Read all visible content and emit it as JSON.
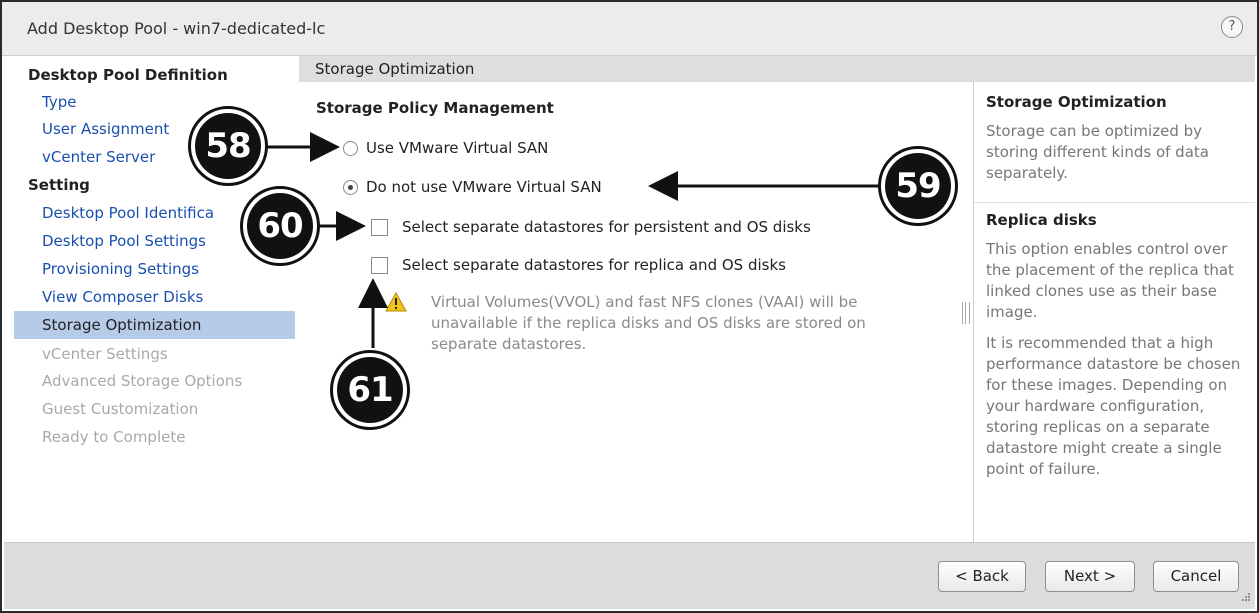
{
  "window": {
    "title": "Add Desktop Pool - win7-dedicated-lc",
    "help_label": "?"
  },
  "nav": {
    "sections": [
      {
        "header": "Desktop Pool Definition",
        "items": [
          {
            "label": "Type",
            "state": "link"
          },
          {
            "label": "User Assignment",
            "state": "link"
          },
          {
            "label": "vCenter Server",
            "state": "link"
          }
        ]
      },
      {
        "header": "Setting",
        "items": [
          {
            "label": "Desktop Pool Identifica",
            "state": "link"
          },
          {
            "label": "Desktop Pool Settings",
            "state": "link"
          },
          {
            "label": "Provisioning Settings",
            "state": "link"
          },
          {
            "label": "View Composer Disks",
            "state": "link"
          },
          {
            "label": "Storage Optimization",
            "state": "selected"
          },
          {
            "label": "vCenter Settings",
            "state": "disabled"
          },
          {
            "label": "Advanced Storage Options",
            "state": "disabled"
          },
          {
            "label": "Guest Customization",
            "state": "disabled"
          },
          {
            "label": "Ready to Complete",
            "state": "disabled"
          }
        ]
      }
    ]
  },
  "main": {
    "section_title": "Storage Optimization",
    "heading": "Storage Policy Management",
    "radio_options": [
      {
        "label": "Use VMware Virtual SAN",
        "checked": false
      },
      {
        "label": "Do not use VMware Virtual SAN",
        "checked": true
      }
    ],
    "checkboxes": [
      {
        "label": "Select separate datastores for persistent and OS disks",
        "checked": false
      },
      {
        "label": "Select separate datastores for replica and OS disks",
        "checked": false
      }
    ],
    "warning": "Virtual Volumes(VVOL) and fast NFS clones (VAAI) will be unavailable if the replica disks and OS disks are stored on separate datastores."
  },
  "help_panel": {
    "blocks": [
      {
        "title": "Storage Optimization",
        "body": "Storage can be optimized by storing different kinds of data separately."
      },
      {
        "title": "Replica disks",
        "body": "This option enables control over the placement of the replica that linked clones use as their base image.",
        "body2": "It is recommended that a high performance datastore be chosen for these images. Depending on your hardware configuration, storing replicas on a separate datastore might create a single point of failure."
      }
    ]
  },
  "footer": {
    "back_label": "< Back",
    "next_label": "Next >",
    "cancel_label": "Cancel"
  },
  "callouts": [
    {
      "label": "58"
    },
    {
      "label": "59"
    },
    {
      "label": "60"
    },
    {
      "label": "61"
    }
  ],
  "colors": {
    "link": "#1a4fb0",
    "selected_row": "#b6cbe8",
    "disabled": "#a9a9a9",
    "warning": "#f0c419"
  },
  "icons": {
    "warning": "warning-icon",
    "help": "help-icon",
    "resize": "resize-grip-icon"
  }
}
